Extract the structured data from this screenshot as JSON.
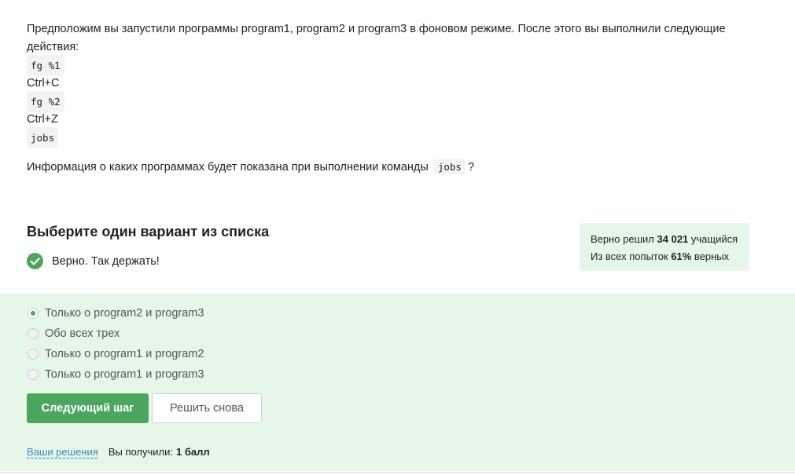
{
  "question": {
    "intro": "Предположим вы запустили программы program1, program2 и program3 в фоновом режиме. После этого вы выполнили следующие действия:",
    "steps": [
      "fg %1",
      "Ctrl+C",
      "fg %2",
      "Ctrl+Z",
      "jobs"
    ],
    "ask_prefix": "Информация о каких программах будет показана при выполнении команды",
    "ask_code": "jobs",
    "ask_suffix": "?"
  },
  "choose_title": "Выберите один вариант из списка",
  "verdict": {
    "text": "Верно. Так держать!",
    "icon": "check-circle-icon",
    "color": "#4ca660"
  },
  "stats": {
    "line1_prefix": "Верно решил",
    "line1_count": "34 021",
    "line1_suffix": "учащийся",
    "line2_prefix": "Из всех попыток",
    "line2_percent": "61%",
    "line2_suffix": "верных"
  },
  "options": [
    {
      "label": "Только о program2 и program3",
      "selected": true
    },
    {
      "label": "Обо всех трех",
      "selected": false
    },
    {
      "label": "Только о program1 и program2",
      "selected": false
    },
    {
      "label": "Только о program1 и program3",
      "selected": false
    }
  ],
  "buttons": {
    "next": "Следующий шаг",
    "retry": "Решить снова"
  },
  "footer": {
    "link": "Ваши решения",
    "score_prefix": "Вы получили:",
    "score_value": "1 балл"
  },
  "colors": {
    "accent": "#4ca660",
    "answer_bg": "#e6f7e9",
    "link": "#3e87c3"
  }
}
